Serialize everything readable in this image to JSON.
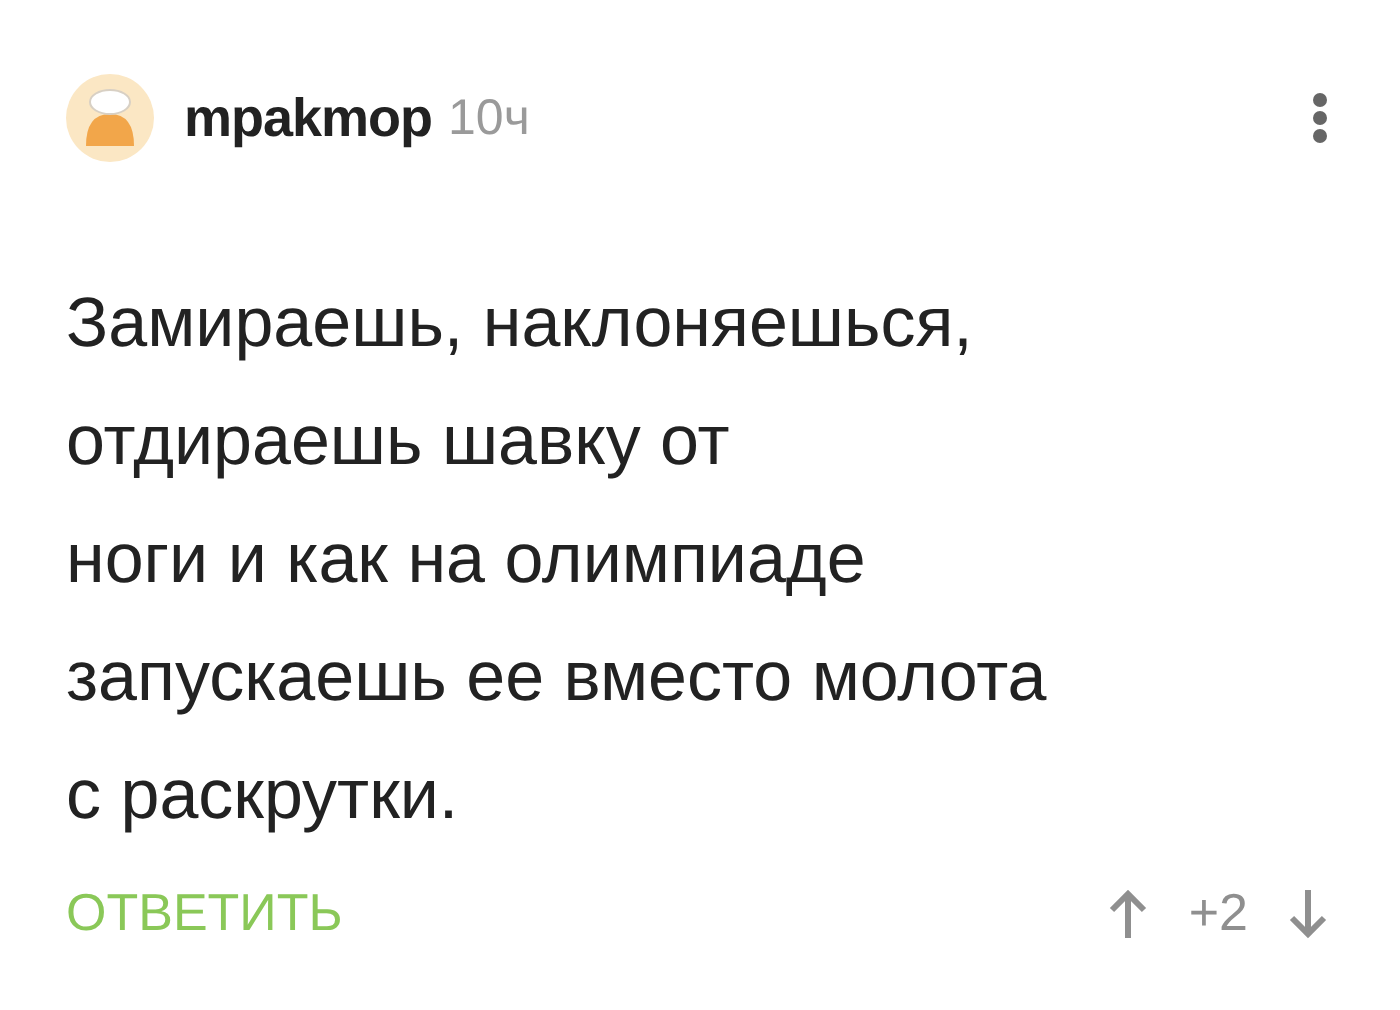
{
  "comment": {
    "author": "mpakmop",
    "time": "10ч",
    "text": "Замираешь, наклоняешься,\nотдираешь шавку от\nноги и как на олимпиаде\nзапускаешь ее вместо молота\nс раскрутки.",
    "reply": "ОТВЕТИТЬ",
    "rating": "+2"
  }
}
